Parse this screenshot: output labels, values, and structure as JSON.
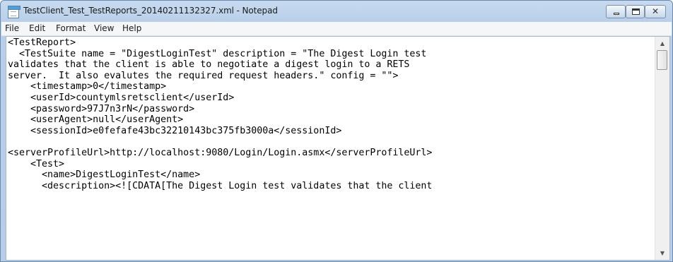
{
  "window": {
    "title": "TestClient_Test_TestReports_20140211132327.xml - Notepad",
    "close_glyph": "✕"
  },
  "menu": {
    "items": [
      "File",
      "Edit",
      "Format",
      "View",
      "Help"
    ]
  },
  "editor": {
    "lines": [
      "<TestReport>",
      "  <TestSuite name = \"DigestLoginTest\" description = \"The Digest Login test",
      "validates that the client is able to negotiate a digest login to a RETS",
      "server.  It also evalutes the required request headers.\" config = \"\">",
      "    <timestamp>0</timestamp>",
      "    <userId>countymlsretsclient</userId>",
      "    <password>97J7n3rN</password>",
      "    <userAgent>null</userAgent>",
      "    <sessionId>e0fefafe43bc32210143bc375fb3000a</sessionId>",
      "",
      "<serverProfileUrl>http://localhost:9080/Login/Login.asmx</serverProfileUrl>",
      "    <Test>",
      "      <name>DigestLoginTest</name>",
      "      <description><![CDATA[The Digest Login test validates that the client"
    ]
  },
  "scrollbar": {
    "up_arrow": "▲",
    "down_arrow": "▼"
  },
  "icons": {
    "app": "notepad-icon",
    "minimize": "minimize-icon",
    "maximize": "maximize-icon",
    "close": "close-icon"
  }
}
